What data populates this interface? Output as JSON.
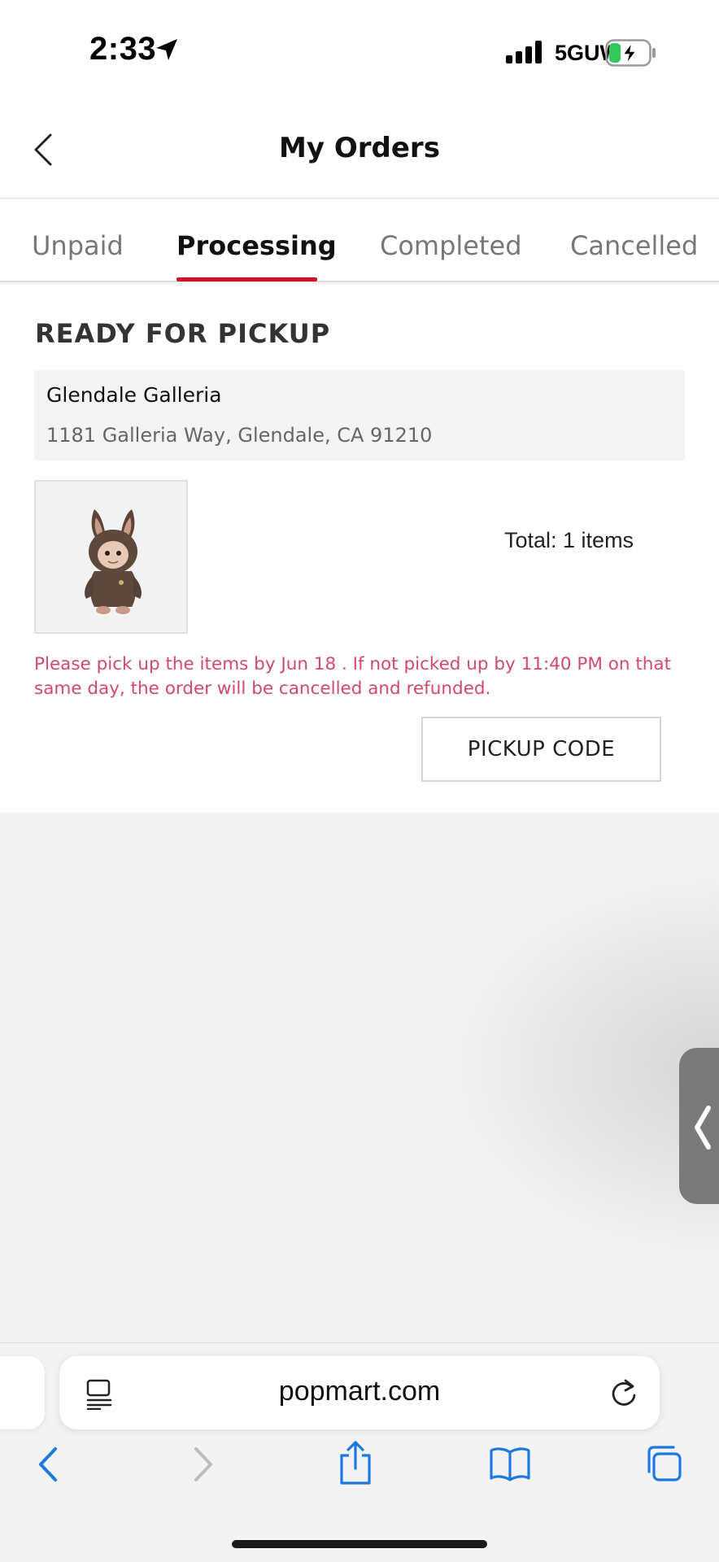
{
  "status_bar": {
    "time": "2:33",
    "network": "5GUW",
    "location_icon": "location-arrow-icon",
    "signal_icon": "cellular-signal-icon",
    "battery_icon": "battery-charging-icon"
  },
  "header": {
    "title": "My Orders",
    "back_icon": "chevron-left-icon"
  },
  "tabs": [
    {
      "label": "Unpaid",
      "active": false
    },
    {
      "label": "Processing",
      "active": true
    },
    {
      "label": "Completed",
      "active": false
    },
    {
      "label": "Cancelled",
      "active": false
    }
  ],
  "order": {
    "status": "READY FOR PICKUP",
    "store_name": "Glendale Galleria",
    "store_address": "1181 Galleria Way, Glendale, CA 91210",
    "total": "Total: 1 items",
    "notice": "Please pick up the items by Jun 18 . If not picked up by 11:40 PM on that same day, the order will be cancelled and refunded.",
    "pickup_button": "PICKUP CODE"
  },
  "browser": {
    "url": "popmart.com",
    "toolbar_icons": [
      "back-arrow-icon",
      "forward-arrow-icon",
      "share-icon",
      "bookmarks-icon",
      "tabs-icon"
    ]
  },
  "colors": {
    "accent": "#d0102b",
    "notice": "#d14a6a",
    "ios_blue": "#1a7ae0"
  }
}
